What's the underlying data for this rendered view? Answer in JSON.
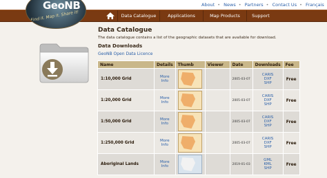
{
  "header": {
    "logo_text": "GeoNB",
    "logo_tagline": "Find it. Map it. Share it!",
    "top_links": [
      "About",
      "News",
      "Partners",
      "Contact Us",
      "Français"
    ],
    "nav": [
      "Data Catalogue",
      "Applications",
      "Map Products",
      "Support"
    ]
  },
  "page": {
    "title": "Data Catalogue",
    "intro": "The data catalogue contains a list of the geographic datasets that are available for download.",
    "section": "Data Downloads",
    "licence_link": "GeoNB Open Data Licence"
  },
  "table": {
    "headers": [
      "Name",
      "Details",
      "Thumb",
      "Viewer",
      "Date",
      "Downloads",
      "Fee"
    ],
    "rows": [
      {
        "name": "1:10,000 Grid",
        "details": "More Info",
        "date": "2005-03-07",
        "downloads": [
          "CARIS",
          "DXF",
          "SHP"
        ],
        "fee": "Free"
      },
      {
        "name": "1:20,000 Grid",
        "details": "More Info",
        "date": "2005-03-07",
        "downloads": [
          "CARIS",
          "DXF",
          "SHP"
        ],
        "fee": "Free"
      },
      {
        "name": "1:50,000 Grid",
        "details": "More Info",
        "date": "2005-03-07",
        "downloads": [
          "CARIS",
          "DXF",
          "SHP"
        ],
        "fee": "Free"
      },
      {
        "name": "1:250,000 Grid",
        "details": "More Info",
        "date": "2005-03-07",
        "downloads": [
          "CARIS",
          "DXF",
          "SHP"
        ],
        "fee": "Free"
      },
      {
        "name": "Aboriginal Lands",
        "details": "More Info",
        "date": "2019-01-03",
        "downloads": [
          "GML",
          "KML",
          "SHP"
        ],
        "fee": "Free"
      }
    ]
  },
  "colors": {
    "nav_bg": "#7a3a12",
    "table_header": "#c9b78a",
    "link": "#2a5fa8"
  }
}
